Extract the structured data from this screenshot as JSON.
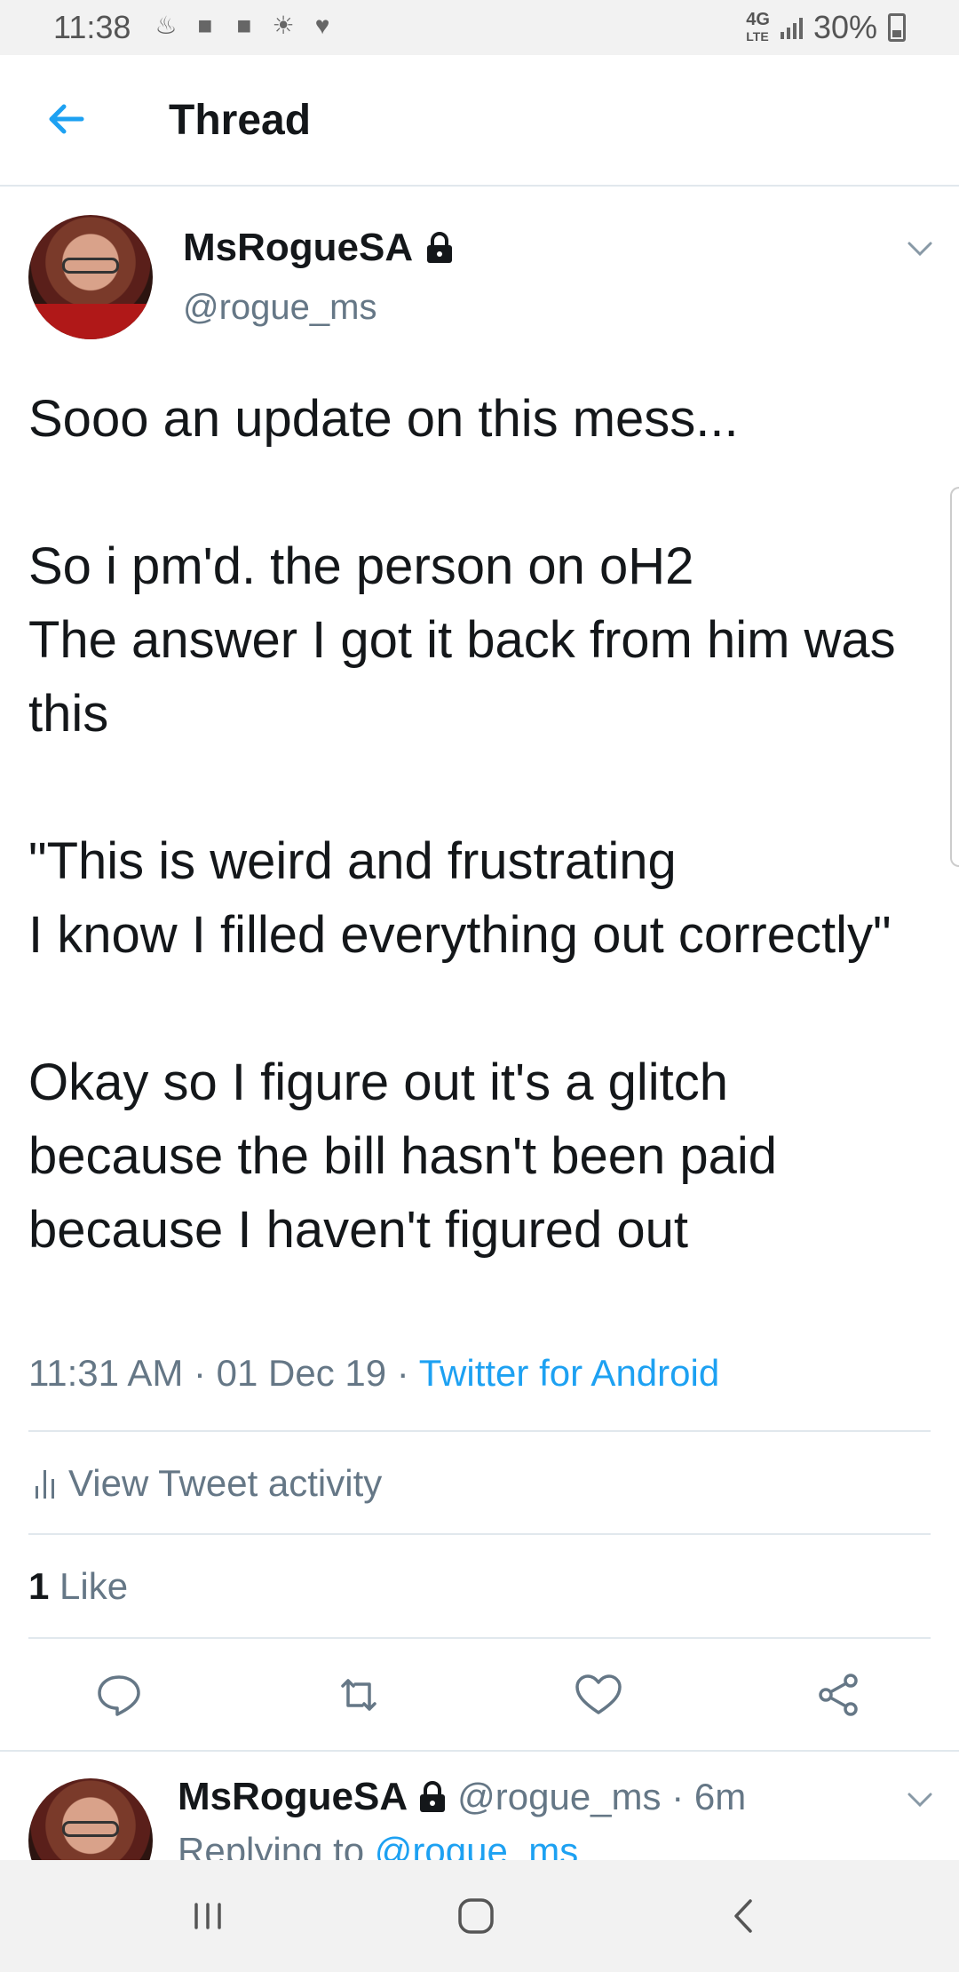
{
  "status_bar": {
    "time": "11:38",
    "network": "4G",
    "network_sub": "LTE",
    "battery": "30%",
    "icons": [
      "cake-icon",
      "video-icon",
      "video-icon",
      "weather-icon",
      "heart-icon"
    ]
  },
  "header": {
    "title": "Thread"
  },
  "tweet": {
    "author_name": "MsRogueSA",
    "author_handle": "@rogue_ms",
    "body": "Sooo an update on this mess...\n\nSo i pm'd. the person on oH2\nThe answer I got it back from him was this\n\n\"This is weird and frustrating\nI know I filled everything out correctly\"\n\nOkay so I figure out it's a glitch because the bill hasn't been paid because I haven't figured out",
    "time": "11:31 AM",
    "date": "01 Dec 19",
    "source": "Twitter for Android",
    "activity_label": "View Tweet activity",
    "like_count": "1",
    "like_label": "Like"
  },
  "reply": {
    "author_name": "MsRogueSA",
    "author_handle": "@rogue_ms",
    "age": "6m",
    "replying_to_prefix": "Replying to",
    "replying_to_handle": "@rogue_ms"
  },
  "colors": {
    "accent": "#1da1f2",
    "secondary_text": "#657786",
    "primary_text": "#14171a",
    "divider": "#e1e8ed"
  }
}
